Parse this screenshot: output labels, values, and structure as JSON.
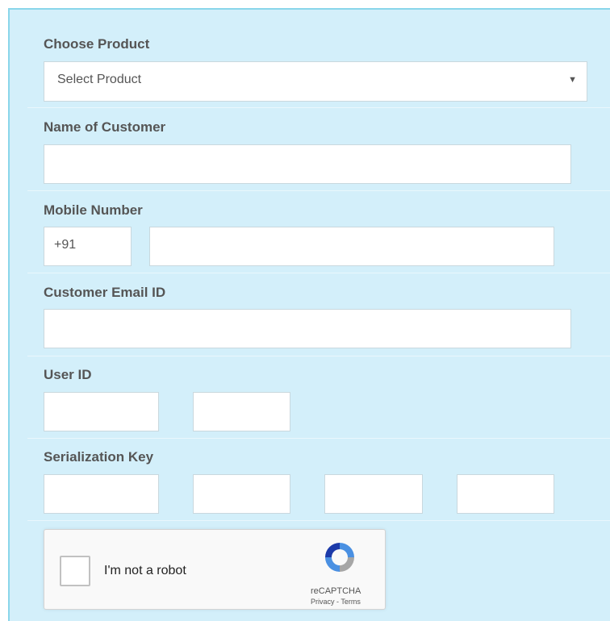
{
  "form": {
    "product_label": "Choose Product",
    "product_select_value": "Select Product",
    "customer_name_label": "Name of Customer",
    "customer_name_value": "",
    "mobile_label": "Mobile Number",
    "mobile_prefix": "+91",
    "mobile_value": "",
    "email_label": "Customer Email ID",
    "email_value": "",
    "user_id_label": "User ID",
    "serial_key_label": "Serialization Key"
  },
  "captcha": {
    "label": "I'm not a robot",
    "brand": "reCAPTCHA",
    "links": "Privacy - Terms"
  },
  "colors": {
    "panel_bg": "#d3effa",
    "panel_border": "#8ad6ea",
    "label_text": "#555555"
  },
  "icons": {
    "caret": "caret-down-icon",
    "recaptcha": "recaptcha-logo-icon"
  }
}
